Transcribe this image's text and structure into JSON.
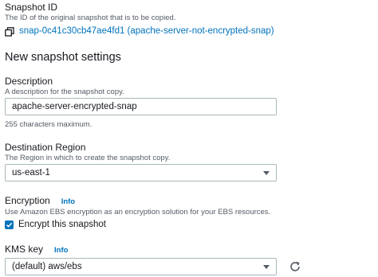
{
  "snapshot_id": {
    "label": "Snapshot ID",
    "description": "The ID of the original snapshot that is to be copied.",
    "value": "snap-0c41c30cb47ae4fd1 (apache-server-not-encrypted-snap)",
    "copy_icon": "copy-icon"
  },
  "section": {
    "title": "New snapshot settings"
  },
  "description_field": {
    "label": "Description",
    "description": "A description for the snapshot copy.",
    "value": "apache-server-encrypted-snap",
    "hint": "255 characters maximum."
  },
  "destination_region": {
    "label": "Destination Region",
    "description": "The Region in which to create the snapshot copy.",
    "value": "us-east-1"
  },
  "encryption": {
    "label": "Encryption",
    "info": "Info",
    "description": "Use Amazon EBS encryption as an encryption solution for your EBS resources.",
    "checkbox_label": "Encrypt this snapshot",
    "checked": true
  },
  "kms_key": {
    "label": "KMS key",
    "info": "Info",
    "value": "(default) aws/ebs",
    "refresh_icon": "refresh-icon"
  },
  "colors": {
    "link": "#0073bb",
    "text": "#16191f",
    "secondary": "#545b64",
    "border": "#aab7b8"
  }
}
